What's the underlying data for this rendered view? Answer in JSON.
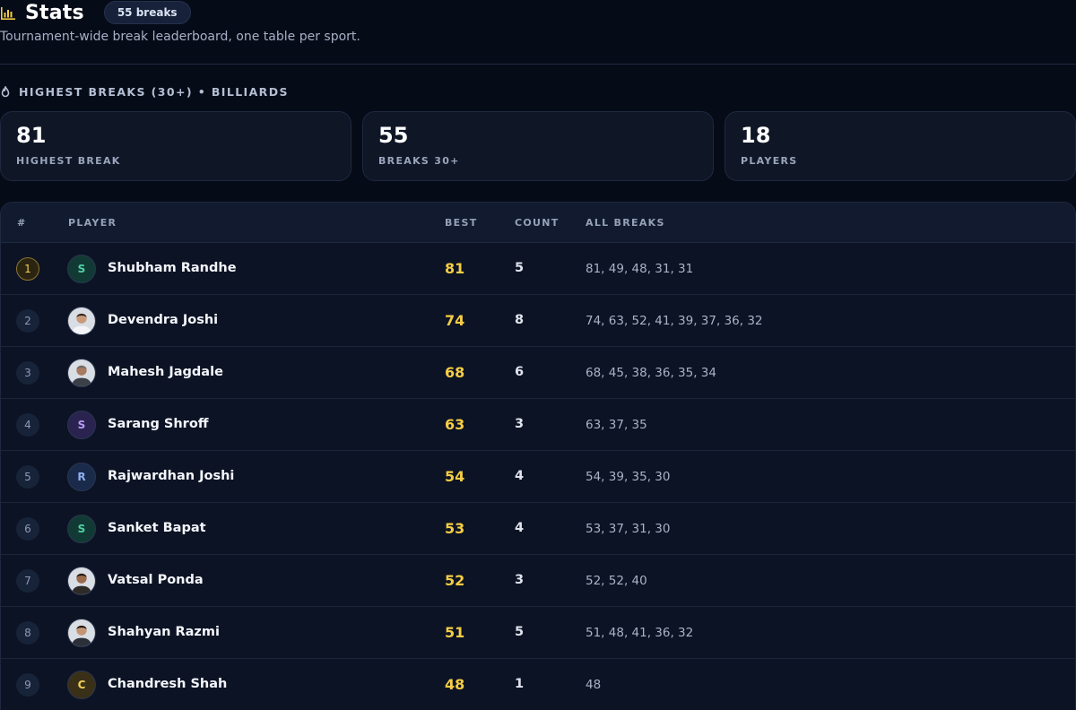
{
  "header": {
    "title": "Stats",
    "badge": "55 breaks",
    "subtitle": "Tournament-wide break leaderboard, one table per sport."
  },
  "section": {
    "title": "HIGHEST BREAKS (30+) • BILLIARDS"
  },
  "summary": [
    {
      "value": "81",
      "label": "HIGHEST BREAK"
    },
    {
      "value": "55",
      "label": "BREAKS 30+"
    },
    {
      "value": "18",
      "label": "PLAYERS"
    }
  ],
  "table": {
    "columns": {
      "rank": "#",
      "player": "PLAYER",
      "best": "BEST",
      "count": "COUNT",
      "all": "ALL BREAKS"
    },
    "rows": [
      {
        "rank": "1",
        "initial": "S",
        "avatar": "initial",
        "name": "Shubham Randhe",
        "best": "81",
        "count": "5",
        "breaks": "81, 49, 48, 31, 31"
      },
      {
        "rank": "2",
        "initial": "",
        "avatar": "photo",
        "name": "Devendra Joshi",
        "best": "74",
        "count": "8",
        "breaks": "74, 63, 52, 41, 39, 37, 36, 32"
      },
      {
        "rank": "3",
        "initial": "",
        "avatar": "photo",
        "name": "Mahesh Jagdale",
        "best": "68",
        "count": "6",
        "breaks": "68, 45, 38, 36, 35, 34"
      },
      {
        "rank": "4",
        "initial": "S",
        "avatar": "initial",
        "name": "Sarang Shroff",
        "best": "63",
        "count": "3",
        "breaks": "63, 37, 35"
      },
      {
        "rank": "5",
        "initial": "R",
        "avatar": "initial",
        "name": "Rajwardhan Joshi",
        "best": "54",
        "count": "4",
        "breaks": "54, 39, 35, 30"
      },
      {
        "rank": "6",
        "initial": "S",
        "avatar": "initial",
        "name": "Sanket Bapat",
        "best": "53",
        "count": "4",
        "breaks": "53, 37, 31, 30"
      },
      {
        "rank": "7",
        "initial": "",
        "avatar": "photo",
        "name": "Vatsal Ponda",
        "best": "52",
        "count": "3",
        "breaks": "52, 52, 40"
      },
      {
        "rank": "8",
        "initial": "",
        "avatar": "photo",
        "name": "Shahyan Razmi",
        "best": "51",
        "count": "5",
        "breaks": "51, 48, 41, 36, 32"
      },
      {
        "rank": "9",
        "initial": "C",
        "avatar": "initial",
        "name": "Chandresh Shah",
        "best": "48",
        "count": "1",
        "breaks": "48"
      }
    ]
  },
  "colors": {
    "accent_gold": "#f5cd45",
    "avatar_green_bg": "#123a34",
    "avatar_green_fg": "#4fd1a5",
    "avatar_purple_bg": "#2a2350",
    "avatar_purple_fg": "#b49cf5",
    "avatar_blue_bg": "#1a2a4a",
    "avatar_blue_fg": "#8fb0f0",
    "avatar_amber_bg": "#3a3018",
    "avatar_amber_fg": "#f2cf58"
  }
}
